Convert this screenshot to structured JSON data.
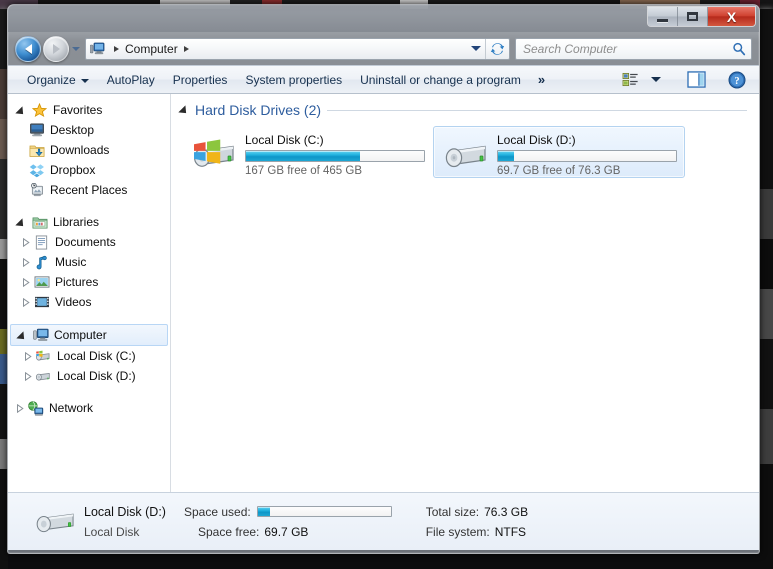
{
  "window": {
    "controls": {
      "minimize": "–",
      "maximize": "□",
      "close": "X"
    }
  },
  "nav": {
    "back_tooltip": "Back",
    "forward_tooltip": "Forward",
    "breadcrumb": {
      "root_icon": "computer-icon",
      "path": "Computer"
    },
    "refresh_icon": "refresh-icon"
  },
  "search": {
    "placeholder": "Search Computer",
    "icon": "search-icon"
  },
  "toolbar": {
    "items": [
      {
        "label": "Organize",
        "has_caret": true
      },
      {
        "label": "AutoPlay",
        "has_caret": false
      },
      {
        "label": "Properties",
        "has_caret": false
      },
      {
        "label": "System properties",
        "has_caret": false
      },
      {
        "label": "Uninstall or change a program",
        "has_caret": false
      }
    ],
    "overflow": "»",
    "view_icon": "view-list-icon",
    "view_caret": "chevron-down-icon",
    "preview_pane_icon": "preview-pane-icon",
    "help_icon": "help-icon"
  },
  "sidebar": {
    "groups": [
      {
        "label": "Favorites",
        "icon": "star-icon",
        "expanded": true,
        "items": [
          {
            "label": "Desktop",
            "icon": "desktop-icon",
            "expandable": false
          },
          {
            "label": "Downloads",
            "icon": "downloads-folder-icon",
            "expandable": false
          },
          {
            "label": "Dropbox",
            "icon": "dropbox-icon",
            "expandable": false
          },
          {
            "label": "Recent Places",
            "icon": "recent-places-icon",
            "expandable": false
          }
        ]
      },
      {
        "label": "Libraries",
        "icon": "libraries-icon",
        "expanded": true,
        "items": [
          {
            "label": "Documents",
            "icon": "documents-icon",
            "expandable": true
          },
          {
            "label": "Music",
            "icon": "music-icon",
            "expandable": true
          },
          {
            "label": "Pictures",
            "icon": "pictures-icon",
            "expandable": true
          },
          {
            "label": "Videos",
            "icon": "videos-icon",
            "expandable": true
          }
        ]
      },
      {
        "label": "Computer",
        "icon": "computer-icon",
        "expanded": true,
        "selected": true,
        "items": [
          {
            "label": "Local Disk (C:)",
            "icon": "system-drive-icon",
            "expandable": true
          },
          {
            "label": "Local Disk (D:)",
            "icon": "drive-icon",
            "expandable": true
          }
        ]
      },
      {
        "label": "Network",
        "icon": "network-icon",
        "expanded": false,
        "items": []
      }
    ]
  },
  "content": {
    "group": {
      "label": "Hard Disk Drives (2)"
    },
    "drives": [
      {
        "name": "Local Disk (C:)",
        "capacity_text": "167 GB free of 465 GB",
        "free_gb": 167,
        "total_gb": 465,
        "used_percent": 64,
        "icon": "system-drive-icon",
        "selected": false
      },
      {
        "name": "Local Disk (D:)",
        "capacity_text": "69.7 GB free of 76.3 GB",
        "free_gb": 69.7,
        "total_gb": 76.3,
        "used_percent": 9,
        "icon": "drive-icon",
        "selected": true
      }
    ]
  },
  "status": {
    "icon": "drive-icon",
    "name": "Local Disk (D:)",
    "type": "Local Disk",
    "space_used_label": "Space used:",
    "space_used_percent": 9,
    "space_free_label": "Space free:",
    "space_free_value": "69.7 GB",
    "total_size_label": "Total size:",
    "total_size_value": "76.3 GB",
    "file_system_label": "File system:",
    "file_system_value": "NTFS"
  },
  "colors": {
    "accent_blue": "#2e5d9e",
    "bar_fill": "#23b3e0",
    "selection_bg": "#ddebfb",
    "selection_border": "#b4d3f0"
  }
}
